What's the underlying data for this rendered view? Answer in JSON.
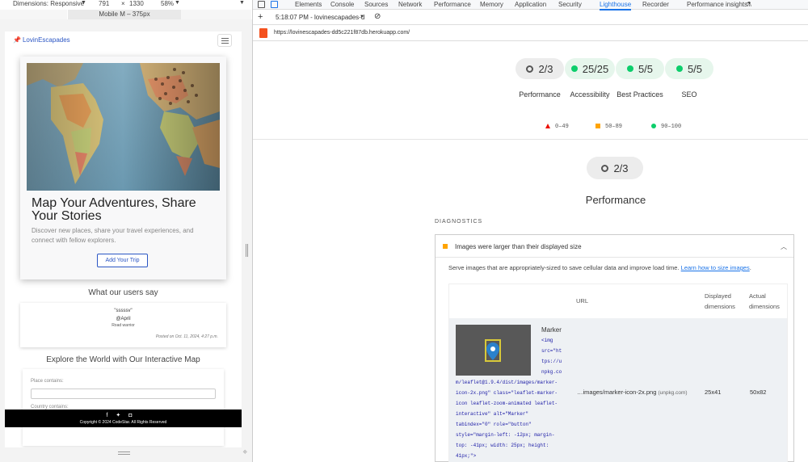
{
  "device_toolbar": {
    "dimensions_label": "Dimensions: Responsive",
    "width": "791",
    "times": "×",
    "height": "1330",
    "zoom": "58%",
    "device_label": "Mobile M – 375px"
  },
  "site": {
    "brand": "LovinEscapades",
    "hero_title": "Map Your Adventures, Share Your Stories",
    "hero_text": "Discover new places, share your travel experiences, and connect with fellow explorers.",
    "add_trip": "Add Your Trip",
    "users_title": "What our users say",
    "review": {
      "quote": "\"sssssv\"",
      "user": "@April",
      "role": "Road warrior",
      "date": "Posted on Oct. 11, 2024, 4:27 p.m."
    },
    "explore_title": "Explore the World with Our Interactive Map",
    "place_label": "Place contains:",
    "country_label": "Country contains:",
    "footer_copy": "Copyright © 2024 CodeStar. All Rights Reserved"
  },
  "devtools": {
    "tabs": [
      "Elements",
      "Console",
      "Sources",
      "Network",
      "Performance",
      "Memory",
      "Application",
      "Security",
      "Lighthouse",
      "Recorder",
      "Performance insights"
    ],
    "active_tab": "Lighthouse",
    "report_time": "5:18:07 PM - lovinescapades-d",
    "url": "https://lovinescapades-dd5c221f87db.herokuapp.com/",
    "scores": [
      {
        "label": "Performance",
        "value": "2/3",
        "status": "partial"
      },
      {
        "label": "Accessibility",
        "value": "25/25",
        "status": "pass"
      },
      {
        "label": "Best Practices",
        "value": "5/5",
        "status": "pass"
      },
      {
        "label": "SEO",
        "value": "5/5",
        "status": "pass"
      }
    ],
    "legend": {
      "low": "0–49",
      "mid": "50–89",
      "high": "90–100"
    },
    "perf_score": "2/3",
    "perf_title": "Performance",
    "diagnostics": "DIAGNOSTICS",
    "audit": {
      "title": "Images were larger than their displayed size",
      "desc": "Serve images that are appropriately-sized to save cellular data and improve load time.",
      "link": "Learn how to size images",
      "col_url": "URL",
      "col_displayed_1": "Displayed",
      "col_displayed_2": "dimensions",
      "col_actual_1": "Actual",
      "col_actual_2": "dimensions",
      "row_name": "Marker",
      "code_lines_short": [
        "<img",
        "src=\"ht",
        "tps://u",
        "npkg.co"
      ],
      "code_lines_long": [
        "m/leaflet@1.9.4/dist/images/marker-",
        "icon-2x.png\" class=\"leaflet-marker-",
        "icon leaflet-zoom-animated leaflet-",
        "interactive\" alt=\"Marker\"",
        "tabindex=\"0\" role=\"button\"",
        "style=\"margin-left: -12px; margin-",
        "top: -41px; width: 25px; height:",
        "41px;\">"
      ],
      "url_path": "…images/marker-icon-2x.png",
      "url_domain": "(unpkg.com)",
      "displayed": "25x41",
      "actual": "50x82"
    }
  },
  "colors": {
    "pass": "#0cce6b",
    "average": "#ffa400",
    "fail": "#eb0f00",
    "link": "#1a73e8",
    "brand": "#2b56c4"
  }
}
